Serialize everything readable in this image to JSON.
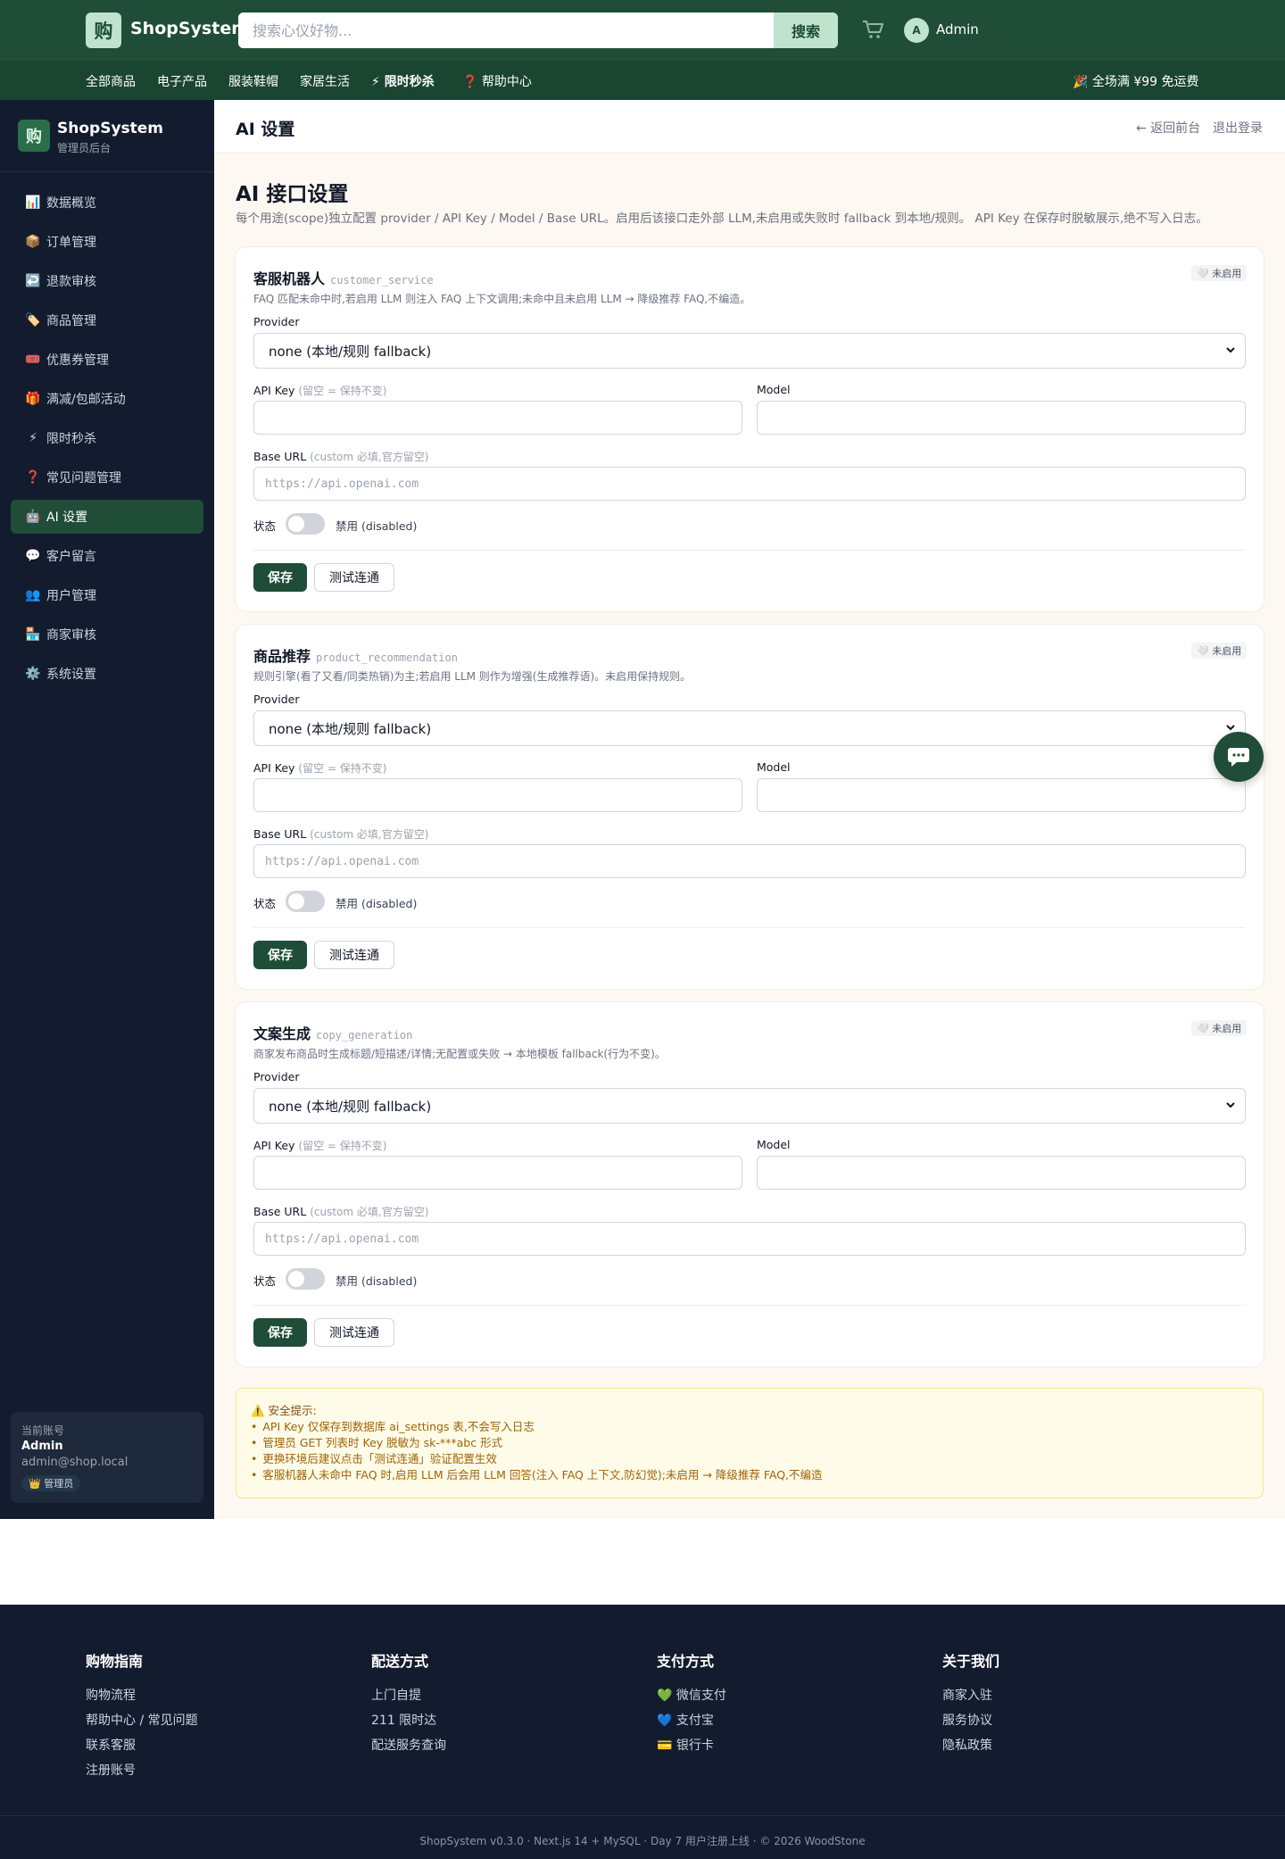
{
  "header": {
    "logo_char": "购",
    "brand": "ShopSystem",
    "search_placeholder": "搜索心仪好物...",
    "search_button": "搜索",
    "avatar_initial": "A",
    "user_name": "Admin"
  },
  "nav": {
    "items": [
      {
        "label": "全部商品"
      },
      {
        "label": "电子产品"
      },
      {
        "label": "服装鞋帽"
      },
      {
        "label": "家居生活"
      },
      {
        "label": "⚡ 限时秒杀"
      },
      {
        "label": "❓ 帮助中心"
      }
    ],
    "promo": "🎉 全场满 ¥99 免运费"
  },
  "sidebar": {
    "logo_char": "购",
    "title": "ShopSystem",
    "subtitle": "管理员后台",
    "items": [
      {
        "icon": "📊",
        "label": "数据概览"
      },
      {
        "icon": "📦",
        "label": "订单管理"
      },
      {
        "icon": "↩️",
        "label": "退款审核"
      },
      {
        "icon": "🏷️",
        "label": "商品管理"
      },
      {
        "icon": "🎟️",
        "label": "优惠券管理"
      },
      {
        "icon": "🎁",
        "label": "满减/包邮活动"
      },
      {
        "icon": "⚡",
        "label": "限时秒杀"
      },
      {
        "icon": "❓",
        "label": "常见问题管理"
      },
      {
        "icon": "🤖",
        "label": "AI 设置"
      },
      {
        "icon": "💬",
        "label": "客户留言"
      },
      {
        "icon": "👥",
        "label": "用户管理"
      },
      {
        "icon": "🏪",
        "label": "商家审核"
      },
      {
        "icon": "⚙️",
        "label": "系统设置"
      }
    ],
    "active_index": 8,
    "account": {
      "label": "当前账号",
      "name": "Admin",
      "email": "admin@shop.local",
      "role": "👑 管理员"
    }
  },
  "page": {
    "title": "AI 设置",
    "back_link": "← 返回前台",
    "logout": "退出登录",
    "heading": "AI 接口设置",
    "description": "每个用途(scope)独立配置 provider / API Key / Model / Base URL。启用后该接口走外部 LLM,未启用或失败时 fallback 到本地/规则。 API Key 在保存时脱敏展示,绝不写入日志。"
  },
  "form_labels": {
    "provider": "Provider",
    "api_key": "API Key",
    "api_key_hint": "(留空 = 保持不变)",
    "model": "Model",
    "base_url": "Base URL",
    "base_url_hint": "(custom 必填,官方留空)",
    "base_url_placeholder": "https://api.openai.com",
    "status": "状态",
    "status_value": "禁用 (disabled)",
    "save": "保存",
    "test": "测试连通"
  },
  "cards": [
    {
      "title": "客服机器人",
      "scope": "customer_service",
      "badge": "🤍 未启用",
      "description": "FAQ 匹配未命中时,若启用 LLM 则注入 FAQ 上下文调用;未命中且未启用 LLM → 降级推荐 FAQ,不编造。",
      "provider": "none (本地/规则 fallback)",
      "api_key": "",
      "model": "",
      "base_url": "",
      "enabled": false
    },
    {
      "title": "商品推荐",
      "scope": "product_recommendation",
      "badge": "🤍 未启用",
      "description": "规则引擎(看了又看/同类热销)为主;若启用 LLM 则作为增强(生成推荐语)。未启用保持规则。",
      "provider": "none (本地/规则 fallback)",
      "api_key": "",
      "model": "",
      "base_url": "",
      "enabled": false
    },
    {
      "title": "文案生成",
      "scope": "copy_generation",
      "badge": "🤍 未启用",
      "description": "商家发布商品时生成标题/短描述/详情;无配置或失败 → 本地模板 fallback(行为不变)。",
      "provider": "none (本地/规则 fallback)",
      "api_key": "",
      "model": "",
      "base_url": "",
      "enabled": false
    }
  ],
  "notice": {
    "title": "⚠️ 安全提示:",
    "items": [
      "API Key 仅保存到数据库 ai_settings 表,不会写入日志",
      "管理员 GET 列表时 Key 脱敏为 sk-***abc 形式",
      "更换环境后建议点击「测试连通」验证配置生效",
      "客服机器人未命中 FAQ 时,启用 LLM 后会用 LLM 回答(注入 FAQ 上下文,防幻觉);未启用 → 降级推荐 FAQ,不编造"
    ]
  },
  "footer": {
    "columns": [
      {
        "title": "购物指南",
        "links": [
          "购物流程",
          "帮助中心 / 常见问题",
          "联系客服",
          "注册账号"
        ]
      },
      {
        "title": "配送方式",
        "links": [
          "上门自提",
          "211 限时达",
          "配送服务查询"
        ]
      },
      {
        "title": "支付方式",
        "links": [
          "💚 微信支付",
          "💙 支付宝",
          "💳 银行卡"
        ]
      },
      {
        "title": "关于我们",
        "links": [
          "商家入驻",
          "服务协议",
          "隐私政策"
        ]
      }
    ],
    "copyright": "ShopSystem v0.3.0 · Next.js 14 + MySQL · Day 7 用户注册上线 · © 2026 WoodStone"
  },
  "colors": {
    "brand_green": "#1f4d38",
    "sidebar_dark": "#131c2e",
    "accent_mint": "#bfe3cd"
  }
}
